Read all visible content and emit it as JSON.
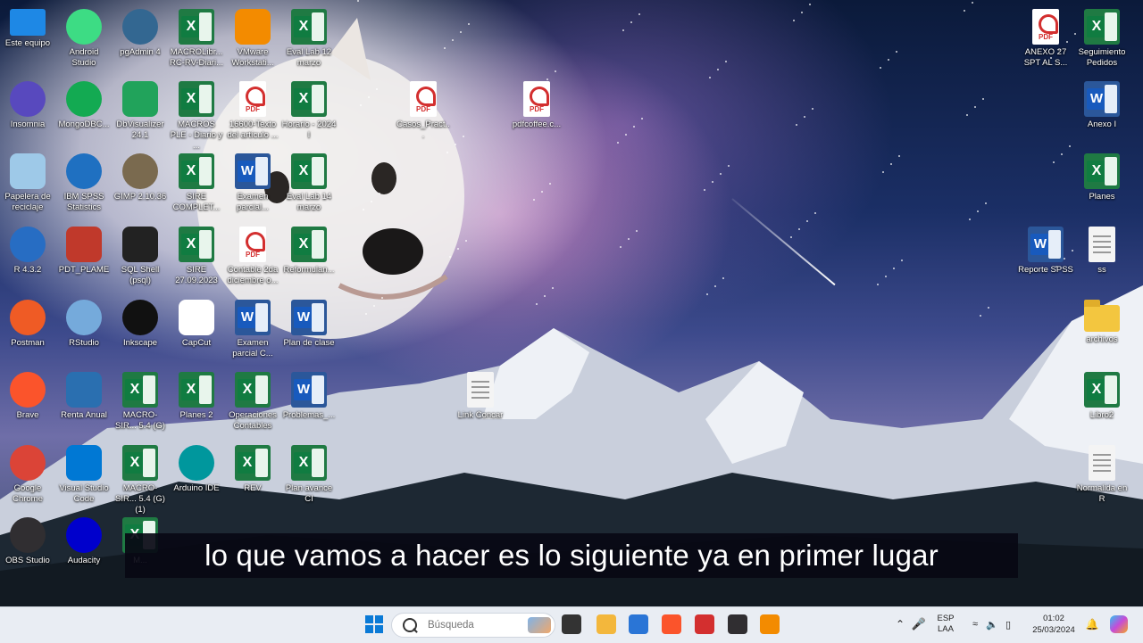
{
  "desktop_icons": [
    {
      "label": "Este equipo",
      "kind": "monitor",
      "color": "#1e88e5"
    },
    {
      "label": "Android Studio",
      "kind": "round",
      "color": "#3ddc84"
    },
    {
      "label": "pgAdmin 4",
      "kind": "round",
      "color": "#336791"
    },
    {
      "label": "MACROLibr... RC-RV-Diari...",
      "kind": "excel"
    },
    {
      "label": "VMware Workstati...",
      "kind": "square",
      "color": "#f38b00"
    },
    {
      "label": "Eval Lab 12 marzo",
      "kind": "excel"
    },
    {
      "label": "Insomnia",
      "kind": "round",
      "color": "#5849be"
    },
    {
      "label": "MongoDBC...",
      "kind": "round",
      "color": "#13aa52"
    },
    {
      "label": "DbVisualizer 24.1",
      "kind": "square",
      "color": "#21a35b"
    },
    {
      "label": "MACROS PLE - Diario y ...",
      "kind": "excel"
    },
    {
      "label": "16600-Texto del artículo ...",
      "kind": "pdf"
    },
    {
      "label": "Horario - 2024 I",
      "kind": "excel"
    },
    {
      "label": "Casos_Pract...",
      "kind": "pdf"
    },
    {
      "label": "pdfcoffee.c...",
      "kind": "pdf"
    },
    {
      "label": "Papelera de reciclaje",
      "kind": "square",
      "color": "#9ec9e8"
    },
    {
      "label": "IBM SPSS Statistics",
      "kind": "round",
      "color": "#1f70c1"
    },
    {
      "label": "GIMP 2.10.36",
      "kind": "round",
      "color": "#7a6a4f"
    },
    {
      "label": "SIRE COMPLET...",
      "kind": "excel"
    },
    {
      "label": "Examen parcial...",
      "kind": "word"
    },
    {
      "label": "Eval Lab 14 marzo",
      "kind": "excel"
    },
    {
      "label": "R 4.3.2",
      "kind": "round",
      "color": "#276dc3"
    },
    {
      "label": "PDT_PLAME",
      "kind": "square",
      "color": "#c0392b"
    },
    {
      "label": "SQL Shell (psql)",
      "kind": "square",
      "color": "#222222"
    },
    {
      "label": "SIRE 27.09.2023",
      "kind": "excel"
    },
    {
      "label": "Contable 2da diciembre o...",
      "kind": "pdf"
    },
    {
      "label": "Reformulan...",
      "kind": "excel"
    },
    {
      "label": "Postman",
      "kind": "round",
      "color": "#ef5b25"
    },
    {
      "label": "RStudio",
      "kind": "round",
      "color": "#75aadb"
    },
    {
      "label": "Inkscape",
      "kind": "round",
      "color": "#111111"
    },
    {
      "label": "CapCut",
      "kind": "square",
      "color": "#ffffff"
    },
    {
      "label": "Examen parcial C...",
      "kind": "word"
    },
    {
      "label": "Plan de clase",
      "kind": "word"
    },
    {
      "label": "Brave",
      "kind": "round",
      "color": "#fb542b"
    },
    {
      "label": "Renta Anual",
      "kind": "square",
      "color": "#2a6fb0"
    },
    {
      "label": "MACRO-SIR... 5.4 (G)",
      "kind": "excel"
    },
    {
      "label": "Planes 2",
      "kind": "excel"
    },
    {
      "label": "Operaciones Contables",
      "kind": "excel"
    },
    {
      "label": "Problemas_...",
      "kind": "word"
    },
    {
      "label": "Link Concar",
      "kind": "txt"
    },
    {
      "label": "Google Chrome",
      "kind": "round",
      "color": "#db4437"
    },
    {
      "label": "Visual Studio Code",
      "kind": "square",
      "color": "#0078d4"
    },
    {
      "label": "MACRO-SIR... 5.4 (G) (1)",
      "kind": "excel"
    },
    {
      "label": "Arduino IDE",
      "kind": "round",
      "color": "#00979d"
    },
    {
      "label": "REV",
      "kind": "excel"
    },
    {
      "label": "Plan avance CI",
      "kind": "excel"
    },
    {
      "label": "OBS Studio",
      "kind": "round",
      "color": "#302e31"
    },
    {
      "label": "Audacity",
      "kind": "round",
      "color": "#0000cc"
    },
    {
      "label": "M...",
      "kind": "excel"
    },
    {
      "label": "ANEXO 27 SPT AL S...",
      "kind": "pdf"
    },
    {
      "label": "Seguimiento Pedidos",
      "kind": "excel"
    },
    {
      "label": "Anexo I",
      "kind": "word"
    },
    {
      "label": "Planes",
      "kind": "excel"
    },
    {
      "label": "Reporte SPSS",
      "kind": "word"
    },
    {
      "label": "ss",
      "kind": "txt"
    },
    {
      "label": "archivos",
      "kind": "folder"
    },
    {
      "label": "Libro2",
      "kind": "excel"
    },
    {
      "label": "Normalida en R",
      "kind": "txt"
    }
  ],
  "subtitle": "lo que vamos a hacer es lo siguiente ya en primer lugar",
  "taskbar": {
    "search_placeholder": "Búsqueda",
    "apps": [
      {
        "name": "start-icon",
        "color": "#0a7ad6"
      },
      {
        "name": "task-view-icon",
        "color": "#333333"
      },
      {
        "name": "file-explorer-icon",
        "color": "#f3b73c"
      },
      {
        "name": "snipping-tool-icon",
        "color": "#2a75d6"
      },
      {
        "name": "brave-icon",
        "color": "#fb542b"
      },
      {
        "name": "acrobat-icon",
        "color": "#d32f2f"
      },
      {
        "name": "obs-icon",
        "color": "#302e31"
      },
      {
        "name": "vmware-icon",
        "color": "#f38b00"
      }
    ],
    "tray": {
      "lang_top": "ESP",
      "lang_bottom": "LAA",
      "time": "01:02",
      "date": "25/03/2024"
    }
  }
}
